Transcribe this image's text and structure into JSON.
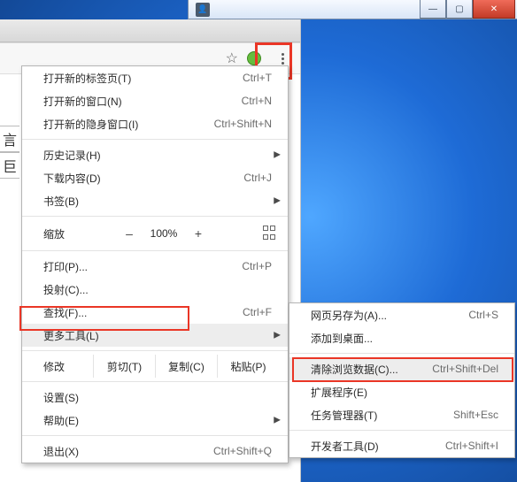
{
  "titlebar": {
    "user_glyph": "👤",
    "min": "—",
    "max": "▢",
    "close": "✕"
  },
  "toolbar": {
    "star_glyph": "☆"
  },
  "menu": {
    "new_tab": "打开新的标签页(T)",
    "new_tab_sc": "Ctrl+T",
    "new_window": "打开新的窗口(N)",
    "new_window_sc": "Ctrl+N",
    "incognito": "打开新的隐身窗口(I)",
    "incognito_sc": "Ctrl+Shift+N",
    "history": "历史记录(H)",
    "downloads": "下载内容(D)",
    "downloads_sc": "Ctrl+J",
    "bookmarks": "书签(B)",
    "zoom_label": "缩放",
    "zoom_minus": "–",
    "zoom_pct": "100%",
    "zoom_plus": "+",
    "print": "打印(P)...",
    "print_sc": "Ctrl+P",
    "cast": "投射(C)...",
    "find": "查找(F)...",
    "find_sc": "Ctrl+F",
    "more_tools": "更多工具(L)",
    "edit_label": "修改",
    "cut": "剪切(T)",
    "copy": "复制(C)",
    "paste": "粘贴(P)",
    "settings": "设置(S)",
    "help": "帮助(E)",
    "exit": "退出(X)",
    "exit_sc": "Ctrl+Shift+Q"
  },
  "submenu": {
    "save_as": "网页另存为(A)...",
    "save_as_sc": "Ctrl+S",
    "add_desktop": "添加到桌面...",
    "clear_data": "清除浏览数据(C)...",
    "clear_sc": "Ctrl+Shift+Del",
    "extensions": "扩展程序(E)",
    "task_mgr": "任务管理器(T)",
    "task_mgr_sc": "Shift+Esc",
    "dev_tools": "开发者工具(D)",
    "dev_tools_sc": "Ctrl+Shift+I"
  },
  "page_frag": {
    "g1": "言",
    "g2": "巨"
  }
}
